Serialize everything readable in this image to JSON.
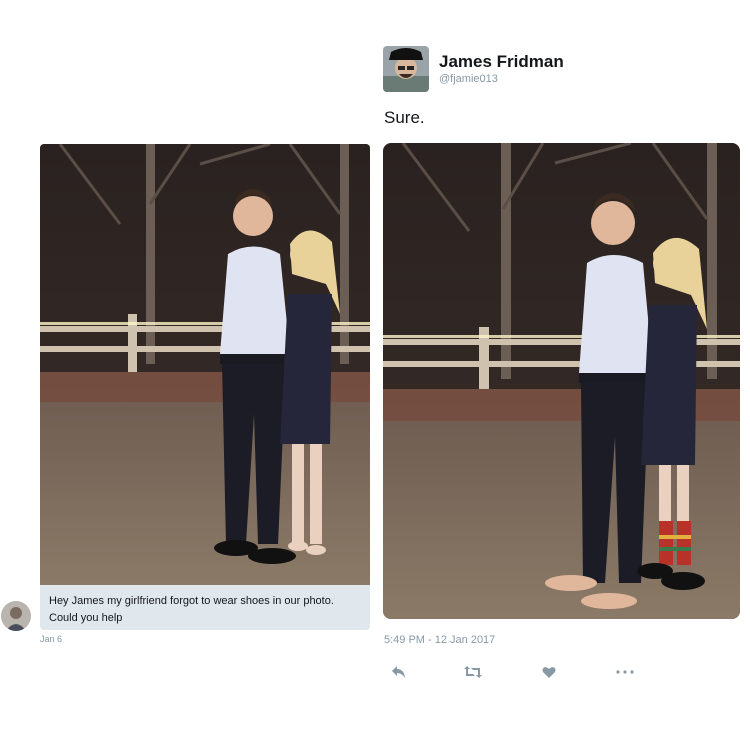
{
  "dm": {
    "message": "Hey James my girlfriend forgot to wear shoes in our photo. Could you help",
    "date": "Jan 6"
  },
  "tweet": {
    "author_name": "James Fridman",
    "author_handle": "@fjamie013",
    "text": "Sure.",
    "timestamp": "5:49 PM - 12 Jan 2017",
    "actions": [
      {
        "name": "reply",
        "icon": "reply-icon"
      },
      {
        "name": "retweet",
        "icon": "retweet-icon"
      },
      {
        "name": "like",
        "icon": "heart-icon"
      },
      {
        "name": "more",
        "icon": "more-icon"
      }
    ]
  },
  "colors": {
    "muted_text": "#8899a6",
    "dm_bubble": "#e1e8ed",
    "primary_text": "#14171a"
  }
}
